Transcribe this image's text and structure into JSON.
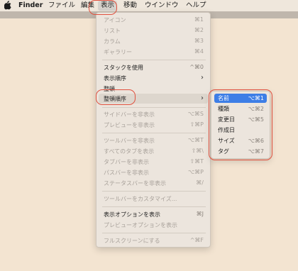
{
  "menubar": {
    "apple_icon": "apple-logo",
    "finder": "Finder",
    "file": "ファイル",
    "edit": "編集",
    "view": "表示",
    "go": "移動",
    "window": "ウインドウ",
    "help": "ヘルプ"
  },
  "view_menu": {
    "icon": {
      "label": "アイコン",
      "shortcut": "⌘1"
    },
    "list": {
      "label": "リスト",
      "shortcut": "⌘2"
    },
    "column": {
      "label": "カラム",
      "shortcut": "⌘3"
    },
    "gallery": {
      "label": "ギャラリー",
      "shortcut": "⌘4"
    },
    "use_stacks": {
      "label": "スタックを使用",
      "shortcut": "^⌘0"
    },
    "sort_by": {
      "label": "表示順序"
    },
    "clean_up": {
      "label": "整頓"
    },
    "clean_up_by": {
      "label": "整頓順序"
    },
    "hide_sidebar": {
      "label": "サイドバーを非表示",
      "shortcut": "⌥⌘S"
    },
    "hide_preview": {
      "label": "プレビューを非表示",
      "shortcut": "⇧⌘P"
    },
    "hide_toolbar": {
      "label": "ツールバーを非表示",
      "shortcut": "⌥⌘T"
    },
    "show_all_tabs": {
      "label": "すべてのタブを表示",
      "shortcut": "⇧⌘\\"
    },
    "hide_tab_bar": {
      "label": "タブバーを非表示",
      "shortcut": "⇧⌘T"
    },
    "hide_path_bar": {
      "label": "パスバーを非表示",
      "shortcut": "⌥⌘P"
    },
    "hide_status_bar": {
      "label": "ステータスバーを非表示",
      "shortcut": "⌘/"
    },
    "customize_toolbar": {
      "label": "ツールバーをカスタマイズ..."
    },
    "show_view_options": {
      "label": "表示オプションを表示",
      "shortcut": "⌘J"
    },
    "show_preview_options": {
      "label": "プレビューオプションを表示"
    },
    "enter_full_screen": {
      "label": "フルスクリーンにする",
      "shortcut": "^⌘F"
    }
  },
  "clean_up_submenu": {
    "name": {
      "label": "名前",
      "shortcut": "⌥⌘1"
    },
    "kind": {
      "label": "種類",
      "shortcut": "⌥⌘2"
    },
    "date_modified": {
      "label": "変更日",
      "shortcut": "⌥⌘5"
    },
    "date_created": {
      "label": "作成日",
      "shortcut": ""
    },
    "size": {
      "label": "サイズ",
      "shortcut": "⌥⌘6"
    },
    "tags": {
      "label": "タグ",
      "shortcut": "⌥⌘7"
    }
  },
  "colors": {
    "desktop": "#f3e4d1",
    "menu_bg": "#ece5dd",
    "selection": "#3d7ee6",
    "annotation": "#e0513f"
  }
}
